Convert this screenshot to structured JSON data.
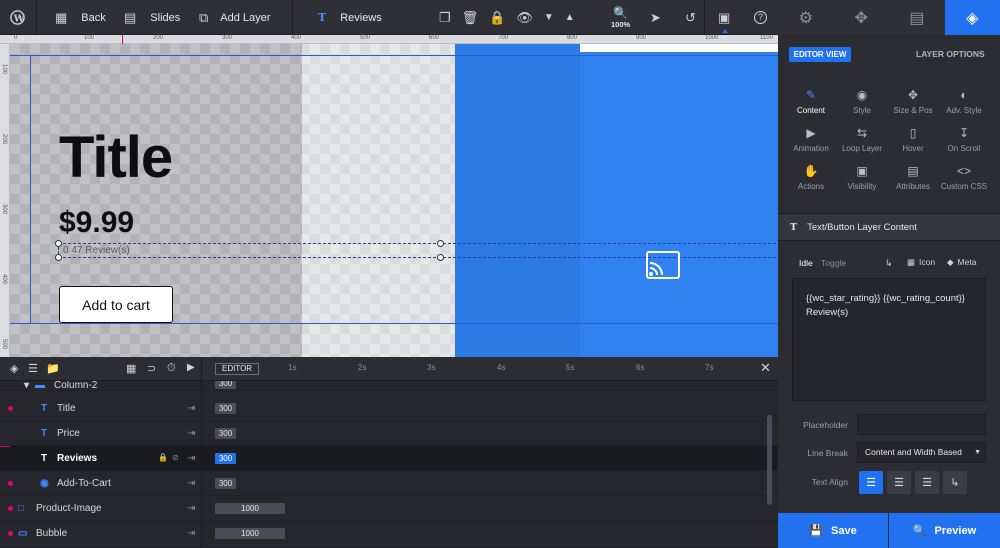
{
  "toolbar": {
    "back_label": "Back",
    "slides_label": "Slides",
    "add_layer_label": "Add Layer",
    "current_layer_label": "Reviews",
    "zoom_label": "100%"
  },
  "panel_tabs": [
    "settings",
    "navigation",
    "slides",
    "layers"
  ],
  "panel": {
    "editor_view_label": "EDITOR VIEW",
    "layer_options_label": "LAYER OPTIONS",
    "grid": [
      {
        "label": "Content",
        "icon": "pen-icon"
      },
      {
        "label": "Style",
        "icon": "palette-icon"
      },
      {
        "label": "Size & Pos",
        "icon": "move-icon"
      },
      {
        "label": "Adv. Style",
        "icon": "contrast-icon"
      },
      {
        "label": "Animation",
        "icon": "play-icon"
      },
      {
        "label": "Loop Layer",
        "icon": "loop-icon"
      },
      {
        "label": "Hover",
        "icon": "mouse-icon"
      },
      {
        "label": "On Scroll",
        "icon": "scroll-icon"
      },
      {
        "label": "Actions",
        "icon": "hand-icon"
      },
      {
        "label": "Visibility",
        "icon": "image-icon"
      },
      {
        "label": "Attributes",
        "icon": "document-icon"
      },
      {
        "label": "Custom CSS",
        "icon": "code-icon"
      }
    ],
    "section_title": "Text/Button Layer Content",
    "state_idle": "Idle",
    "state_toggle": "Toggle",
    "icon_label": "Icon",
    "meta_label": "Meta",
    "content_text": "{{wc_star_rating}} {{wc_rating_count}} Review(s)",
    "placeholder_label": "Placeholder",
    "placeholder_value": "",
    "line_break_label": "Line Break",
    "line_break_value": "Content and Width Based",
    "text_align_label": "Text Align",
    "save_label": "Save",
    "preview_label": "Preview"
  },
  "canvas": {
    "ruler_top": [
      "0",
      "100",
      "200",
      "300",
      "400",
      "500",
      "600",
      "700",
      "800",
      "900",
      "1000",
      "1100"
    ],
    "ruler_left": [
      "100",
      "200",
      "300",
      "400",
      "500"
    ],
    "title_text": "Title",
    "price_text": "$9.99",
    "reviews_text": "0 47 Review(s)",
    "cart_text": "Add to cart"
  },
  "timeline": {
    "editor_label": "EDITOR",
    "ticks": [
      "1s",
      "2s",
      "3s",
      "4s",
      "5s",
      "6s",
      "7s"
    ],
    "rows": [
      {
        "name": "Column-2",
        "icon": "column-icon",
        "bar": "300"
      },
      {
        "name": "Title",
        "icon": "text-icon",
        "bar": "300"
      },
      {
        "name": "Price",
        "icon": "text-icon",
        "bar": "300"
      },
      {
        "name": "Reviews",
        "icon": "text-icon",
        "bar": "300"
      },
      {
        "name": "Add-To-Cart",
        "icon": "button-icon",
        "bar": "300"
      },
      {
        "name": "Product-Image",
        "icon": "image-icon",
        "bar": "1000"
      },
      {
        "name": "Bubble",
        "icon": "shape-icon",
        "bar": "1000"
      }
    ]
  }
}
